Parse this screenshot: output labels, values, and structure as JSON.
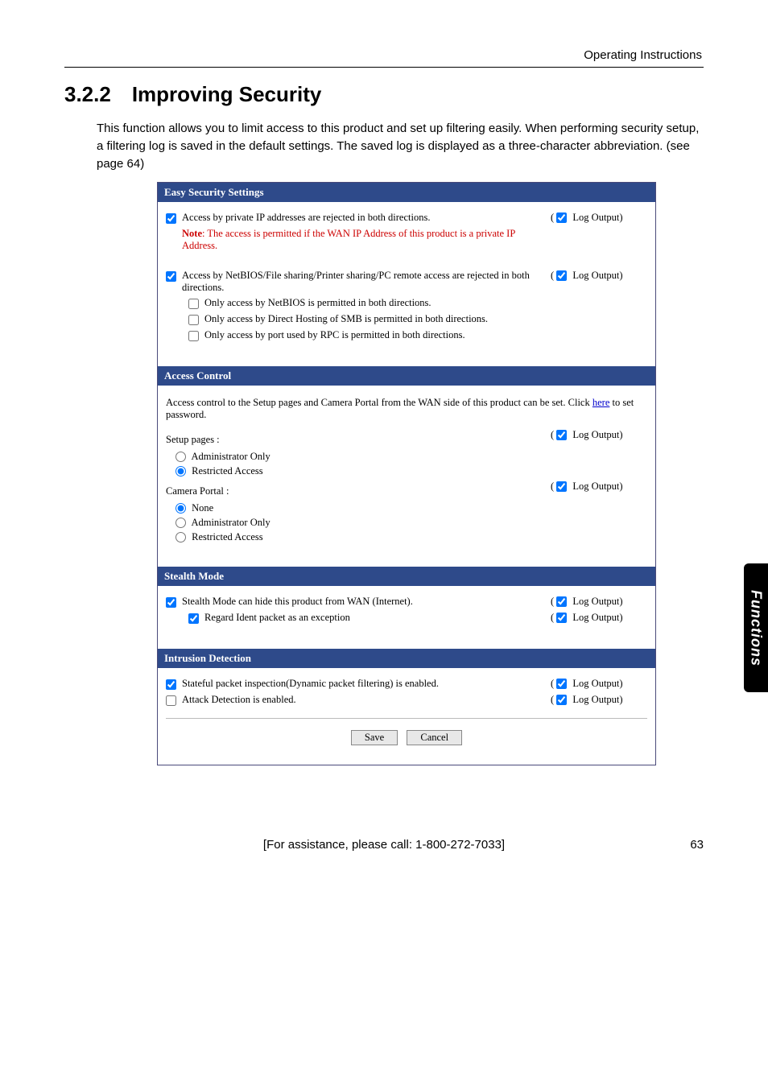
{
  "header": {
    "right": "Operating Instructions"
  },
  "section": {
    "number": "3.2.2",
    "title": "Improving Security"
  },
  "intro": "This function allows you to limit access to this product and set up filtering easily. When performing security setup, a filtering log is saved in the default settings. The saved log is displayed as a three-character abbreviation. (see page 64)",
  "panels": {
    "easy": {
      "heading": "Easy Security Settings",
      "item1": {
        "label": "Access by private IP addresses are rejected in both directions.",
        "note_prefix": "Note",
        "note_body": ": The access is permitted if the WAN IP Address of this product is a private IP Address.",
        "log": "Log Output"
      },
      "item2": {
        "label": "Access by NetBIOS/File sharing/Printer sharing/PC remote access are rejected in both directions.",
        "sub1": "Only access by NetBIOS is permitted in both directions.",
        "sub2": "Only access by Direct Hosting of SMB is permitted in both directions.",
        "sub3": "Only access by port used by RPC is permitted in both directions.",
        "log": "Log Output"
      }
    },
    "access": {
      "heading": "Access Control",
      "intro_a": "Access control to the Setup pages and Camera Portal from the WAN side of this product can be set. Click ",
      "intro_link": "here",
      "intro_b": " to set password.",
      "setup_label": "Setup pages :",
      "setup_opts": {
        "admin": "Administrator Only",
        "restricted": "Restricted Access"
      },
      "camera_label": "Camera Portal :",
      "camera_opts": {
        "none": "None",
        "admin": "Administrator Only",
        "restricted": "Restricted Access"
      },
      "log": "Log Output"
    },
    "stealth": {
      "heading": "Stealth Mode",
      "item1": "Stealth Mode can hide this product from WAN (Internet).",
      "sub1": "Regard Ident packet as an exception",
      "log": "Log Output"
    },
    "intrusion": {
      "heading": "Intrusion Detection",
      "item1": "Stateful packet inspection(Dynamic packet filtering) is enabled.",
      "item2": "Attack Detection is enabled.",
      "log": "Log Output"
    },
    "buttons": {
      "save": "Save",
      "cancel": "Cancel"
    }
  },
  "side_tab": "Functions",
  "footer": {
    "assist": "[For assistance, please call: 1-800-272-7033]",
    "page": "63"
  }
}
